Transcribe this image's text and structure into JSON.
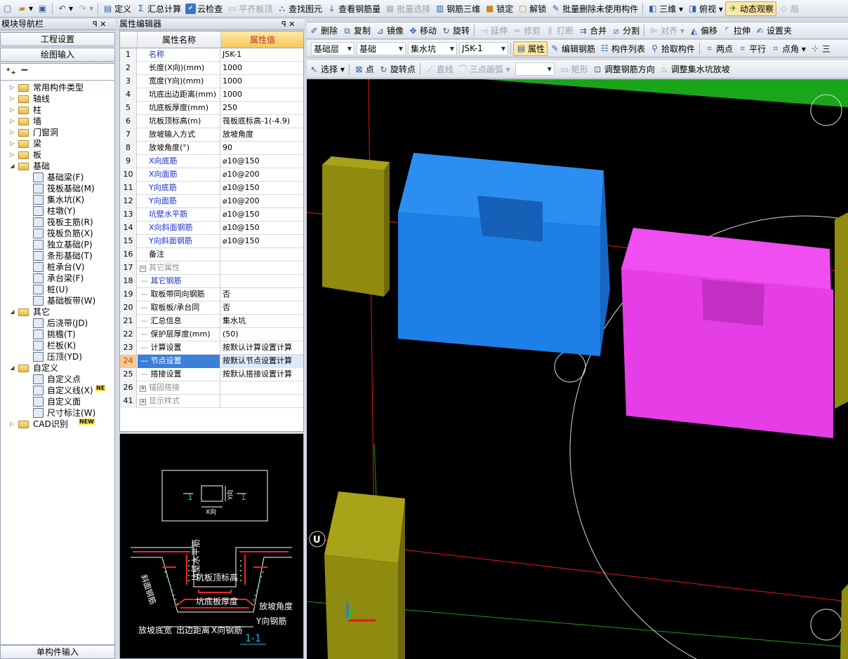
{
  "toolbar1": [
    {
      "icon": "new-file-icon",
      "sym": "▢",
      "label": ""
    },
    {
      "icon": "open-folder-icon",
      "sym": "▰",
      "label": "▾",
      "cls": "y"
    },
    {
      "icon": "save-icon",
      "sym": "▣",
      "label": ""
    },
    {
      "sep": true
    },
    {
      "icon": "undo-icon",
      "sym": "↶",
      "label": "▾"
    },
    {
      "icon": "redo-icon",
      "sym": "↷",
      "label": "▾",
      "dis": true
    },
    {
      "sep": true
    },
    {
      "icon": "define-icon",
      "sym": "▤",
      "label": "定义"
    },
    {
      "icon": "sum-icon",
      "sym": "Σ",
      "label": "汇总计算"
    },
    {
      "icon": "cloud-check-icon",
      "sym": "✔",
      "label": "云检查",
      "ib": true
    },
    {
      "icon": "align-slab-icon",
      "sym": "▭",
      "label": "平齐板顶",
      "dis": true
    },
    {
      "icon": "find-element-icon",
      "sym": "⛬",
      "label": "查找图元"
    },
    {
      "icon": "view-rebar-icon",
      "sym": "ↆ",
      "label": "查看钢筋量"
    },
    {
      "icon": "batch-select-icon",
      "sym": "▦",
      "label": "批量选择",
      "dis": true
    },
    {
      "icon": "rebar-3d-icon",
      "sym": "▥",
      "label": "钢筋三维"
    },
    {
      "icon": "lock-icon",
      "sym": "■",
      "label": "锁定",
      "cls": "y"
    },
    {
      "icon": "unlock-icon",
      "sym": "□",
      "label": "解锁",
      "cls": "y"
    },
    {
      "icon": "batch-delete-icon",
      "sym": "✎",
      "label": "批量删除未使用构件"
    },
    {
      "sep": true
    },
    {
      "icon": "3d-view-icon",
      "sym": "◧",
      "label": "三维 ▾"
    },
    {
      "icon": "top-view-icon",
      "sym": "◨",
      "label": "俯视 ▾"
    },
    {
      "icon": "dynamic-view-icon",
      "sym": "✈",
      "label": "动态观察",
      "on": true,
      "cls": "g"
    },
    {
      "icon": "partial-3d-icon",
      "sym": "◇",
      "label": "局",
      "dis": true
    }
  ],
  "toolbar2": [
    {
      "icon": "delete-icon",
      "sym": "✐",
      "label": "删除"
    },
    {
      "icon": "copy-icon",
      "sym": "⧉",
      "label": "复制"
    },
    {
      "icon": "mirror-icon",
      "sym": "⊿",
      "label": "镜像"
    },
    {
      "icon": "move-icon",
      "sym": "✥",
      "label": "移动"
    },
    {
      "icon": "rotate-icon",
      "sym": "↻",
      "label": "旋转"
    },
    {
      "sep": true
    },
    {
      "icon": "extend-icon",
      "sym": "⊣",
      "label": "延伸",
      "dis": true
    },
    {
      "icon": "trim-icon",
      "sym": "✂",
      "label": "修剪",
      "dis": true
    },
    {
      "icon": "break-icon",
      "sym": "⫼",
      "label": "打断",
      "dis": true
    },
    {
      "icon": "merge-icon",
      "sym": "⇉",
      "label": "合并"
    },
    {
      "icon": "split-icon",
      "sym": "⧄",
      "label": "分割"
    },
    {
      "sep": true
    },
    {
      "icon": "align-icon",
      "sym": "⊫",
      "label": "对齐 ▾",
      "dis": true
    },
    {
      "icon": "offset-icon",
      "sym": "◭",
      "label": "偏移"
    },
    {
      "icon": "stretch-icon",
      "sym": "⌜",
      "label": "拉伸"
    },
    {
      "icon": "set-pit-icon",
      "sym": "✍",
      "label": "设置夹"
    }
  ],
  "toolbar3": {
    "floor_dd": "基础层",
    "category_dd": "基础",
    "type_dd": "集水坑",
    "name_dd": "JSK-1",
    "items": [
      {
        "icon": "property-icon",
        "sym": "▤",
        "label": "属性",
        "on": true
      },
      {
        "icon": "edit-rebar-icon",
        "sym": "✎",
        "label": "编辑钢筋"
      },
      {
        "icon": "component-list-icon",
        "sym": "☷",
        "label": "构件列表"
      },
      {
        "icon": "pick-component-icon",
        "sym": "⚲",
        "label": "拾取构件"
      },
      {
        "sep": true
      },
      {
        "icon": "two-points-icon",
        "sym": "⌗",
        "label": "两点"
      },
      {
        "icon": "parallel-icon",
        "sym": "⌗",
        "label": "平行"
      },
      {
        "icon": "point-angle-icon",
        "sym": "⌗",
        "label": "点角 ▾"
      },
      {
        "icon": "three-point-icon",
        "sym": "⊹",
        "label": "三",
        "cls": "r"
      }
    ]
  },
  "toolbar4": [
    {
      "icon": "select-icon",
      "sym": "↖",
      "label": "选择 ▾"
    },
    {
      "sep": true
    },
    {
      "icon": "point-icon",
      "sym": "⊠",
      "label": "点"
    },
    {
      "icon": "rotate-point-icon",
      "sym": "↻",
      "label": "旋转点"
    },
    {
      "sep": true
    },
    {
      "icon": "line-icon",
      "sym": "⟋",
      "label": "直线",
      "dis": true
    },
    {
      "icon": "arc-icon",
      "sym": "⌒",
      "label": "三点画弧 ▾",
      "dis": true
    },
    {
      "dd": true
    },
    {
      "icon": "rect-icon",
      "sym": "▭",
      "label": "矩形",
      "dis": true
    },
    {
      "icon": "adjust-rebar-dir-icon",
      "sym": "⊡",
      "label": "调整钢筋方向"
    },
    {
      "icon": "adjust-pit-slope-icon",
      "sym": "♨",
      "label": "调整集水坑放坡",
      "cls": "y"
    }
  ],
  "nav": {
    "title": "模块导航栏",
    "pin": "ꟼ ✕",
    "btn_setup": "工程设置",
    "btn_draw": "绘图输入",
    "btn_single": "单构件输入",
    "tree": [
      {
        "d": 0,
        "exp": "▷",
        "type": "f",
        "label": "常用构件类型"
      },
      {
        "d": 0,
        "exp": "▷",
        "type": "f",
        "label": "轴线"
      },
      {
        "d": 0,
        "exp": "▷",
        "type": "f",
        "label": "柱"
      },
      {
        "d": 0,
        "exp": "▷",
        "type": "f",
        "label": "墙"
      },
      {
        "d": 0,
        "exp": "▷",
        "type": "f",
        "label": "门窗洞"
      },
      {
        "d": 0,
        "exp": "▷",
        "type": "f",
        "label": "梁"
      },
      {
        "d": 0,
        "exp": "▷",
        "type": "f",
        "label": "板"
      },
      {
        "d": 0,
        "exp": "◢",
        "type": "f",
        "label": "基础"
      },
      {
        "d": 1,
        "type": "c",
        "label": "基础梁(F)"
      },
      {
        "d": 1,
        "type": "c",
        "label": "筏板基础(M)"
      },
      {
        "d": 1,
        "type": "c",
        "label": "集水坑(K)"
      },
      {
        "d": 1,
        "type": "c",
        "label": "柱墩(Y)"
      },
      {
        "d": 1,
        "type": "c",
        "label": "筏板主筋(R)"
      },
      {
        "d": 1,
        "type": "c",
        "label": "筏板负筋(X)"
      },
      {
        "d": 1,
        "type": "c",
        "label": "独立基础(P)"
      },
      {
        "d": 1,
        "type": "c",
        "label": "条形基础(T)"
      },
      {
        "d": 1,
        "type": "c",
        "label": "桩承台(V)"
      },
      {
        "d": 1,
        "type": "c",
        "label": "承台梁(F)"
      },
      {
        "d": 1,
        "type": "c",
        "label": "桩(U)"
      },
      {
        "d": 1,
        "type": "c",
        "label": "基础板带(W)"
      },
      {
        "d": 0,
        "exp": "◢",
        "type": "f",
        "label": "其它"
      },
      {
        "d": 1,
        "type": "c",
        "label": "后浇带(JD)"
      },
      {
        "d": 1,
        "type": "c",
        "label": "挑檐(T)"
      },
      {
        "d": 1,
        "type": "c",
        "label": "栏板(K)"
      },
      {
        "d": 1,
        "type": "c",
        "label": "压顶(YD)"
      },
      {
        "d": 0,
        "exp": "◢",
        "type": "f",
        "label": "自定义"
      },
      {
        "d": 1,
        "type": "c",
        "label": "自定义点"
      },
      {
        "d": 1,
        "type": "c",
        "label": "自定义线(X)",
        "badge": "NE"
      },
      {
        "d": 1,
        "type": "c",
        "label": "自定义面"
      },
      {
        "d": 1,
        "type": "c",
        "label": "尺寸标注(W)"
      },
      {
        "d": 0,
        "exp": "▷",
        "type": "f",
        "label": "CAD识别",
        "badge": "NEW"
      }
    ]
  },
  "props": {
    "title": "属性编辑器",
    "pin": "ꟼ ✕",
    "col_name": "属性名称",
    "col_value": "属性值",
    "rows": [
      {
        "n": "1",
        "k": "名称",
        "v": "JSK-1",
        "c": "blue"
      },
      {
        "n": "2",
        "k": "长度(X向)(mm)",
        "v": "1000"
      },
      {
        "n": "3",
        "k": "宽度(Y向)(mm)",
        "v": "1000"
      },
      {
        "n": "4",
        "k": "坑底出边距离(mm)",
        "v": "1000"
      },
      {
        "n": "5",
        "k": "坑底板厚度(mm)",
        "v": "250"
      },
      {
        "n": "6",
        "k": "坑板顶标高(m)",
        "v": "筏板底标高-1(-4.9)"
      },
      {
        "n": "7",
        "k": "放坡输入方式",
        "v": "放坡角度"
      },
      {
        "n": "8",
        "k": "放坡角度(°)",
        "v": "90"
      },
      {
        "n": "9",
        "k": "X向底筋",
        "v": "⌀10@150",
        "c": "blue"
      },
      {
        "n": "10",
        "k": "X向面筋",
        "v": "⌀10@200",
        "c": "blue"
      },
      {
        "n": "11",
        "k": "Y向底筋",
        "v": "⌀10@150",
        "c": "blue"
      },
      {
        "n": "12",
        "k": "Y向面筋",
        "v": "⌀10@200",
        "c": "blue"
      },
      {
        "n": "13",
        "k": "坑壁水平筋",
        "v": "⌀10@150",
        "c": "blue"
      },
      {
        "n": "14",
        "k": "X向斜面钢筋",
        "v": "⌀10@150",
        "c": "blue"
      },
      {
        "n": "15",
        "k": "Y向斜面钢筋",
        "v": "⌀10@150",
        "c": "blue"
      },
      {
        "n": "16",
        "k": "备注",
        "v": ""
      },
      {
        "n": "17",
        "k": "其它属性",
        "v": "",
        "c": "grey",
        "g": "−"
      },
      {
        "n": "18",
        "k": "其它钢筋",
        "v": "",
        "c": "blue",
        "tr": true
      },
      {
        "n": "19",
        "k": "取板带同向钢筋",
        "v": "否",
        "tr": true
      },
      {
        "n": "20",
        "k": "取板板/承台同",
        "v": "否",
        "tr": true
      },
      {
        "n": "21",
        "k": "汇总信息",
        "v": "集水坑",
        "tr": true
      },
      {
        "n": "22",
        "k": "保护层厚度(mm)",
        "v": "(50)",
        "tr": true
      },
      {
        "n": "23",
        "k": "计算设置",
        "v": "按默认计算设置计算",
        "tr": true
      },
      {
        "n": "24",
        "k": "节点设置",
        "v": "按默认节点设置计算",
        "tr": true,
        "sel": true
      },
      {
        "n": "25",
        "k": "搭接设置",
        "v": "按默认搭接设置计算",
        "tr": true
      },
      {
        "n": "26",
        "k": "锚固搭接",
        "v": "",
        "c": "grey",
        "g": "+"
      },
      {
        "n": "41",
        "k": "显示样式",
        "v": "",
        "c": "grey",
        "g": "+"
      }
    ]
  },
  "diagram": {
    "sec_no_l": "1",
    "sec_no_r": "1",
    "y_dir": "Y向",
    "x_dir": "X向",
    "wall_horiz": "坑壁水平筋",
    "slab_top": "坑板顶标高",
    "slab_thick": "坑底板厚度",
    "slope_angle": "放坡角度",
    "y_rebar": "Y向钢筋",
    "slope_rebar": "斜面钢筋",
    "slope_width": "放坡底宽",
    "edge_dist": "出边距离",
    "x_rebar": "X向钢筋",
    "section": "1-1"
  },
  "viewport": {
    "axis_label": "U"
  },
  "colors": {
    "pit_blue": "#1e7fe6",
    "pit_magenta": "#e63ee6",
    "pile_olive": "#8f8a10",
    "green_slab": "#1aa51a"
  }
}
